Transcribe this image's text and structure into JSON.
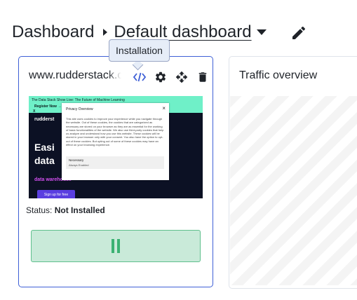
{
  "header": {
    "breadcrumb_root": "Dashboard",
    "dashboard_name": "Default dashboard"
  },
  "widgets": [
    {
      "title": "www.rudderstack.c",
      "tooltip": "Installation",
      "status_label": "Status:",
      "status_value": "Not Installed",
      "action_state": "paused",
      "thumbnail": {
        "banner_text": "The Data Stack Show Live: The Future of Machine Learning",
        "banner_cta": "Register Now →",
        "banner_x": "X",
        "logo": "rudderst",
        "headline_line1": "Easi",
        "headline_line2": "data",
        "subheadline": "data warehouse",
        "cta": "Sign up for free",
        "dialog_title": "Privacy Overview",
        "dialog_close": "×",
        "dialog_text": "This site uses cookies to improve your experience while you navigate through the website. Out of these cookies, the cookies that are categorized as necessary are stored on your browser as they are as essential for the working of basic functionalities of the website. We also use third-party cookies that help us analyze and understand how you use this website. These cookies will be stored in your browser only with your consent. You also have the option to opt-out of these cookies. But opting out of some of these cookies may have an effect on your browsing experience.",
        "dialog_option": "Necessary",
        "dialog_option_state": "Always Enabled"
      }
    },
    {
      "title": "Traffic overview"
    }
  ],
  "colors": {
    "selected_border": "#3e5fd6",
    "action_bg": "#c9ead9",
    "action_border": "#5fc08d",
    "pause_icon": "#3bb273",
    "icon_blue": "#3e5fd6",
    "icon_dark": "#1f2329"
  },
  "icons": [
    "caret-right-icon",
    "caret-down-icon",
    "pencil-icon",
    "code-icon",
    "gear-icon",
    "move-icon",
    "trash-icon",
    "pause-icon"
  ]
}
